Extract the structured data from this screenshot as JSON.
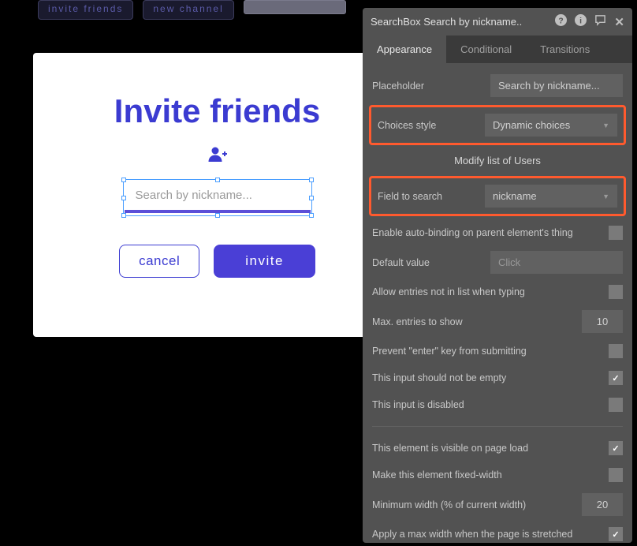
{
  "top": {
    "invite_friends": "invite friends",
    "new_channel": "new channel"
  },
  "modal": {
    "title": "Invite friends",
    "search_placeholder": "Search by nickname...",
    "cancel": "cancel",
    "invite": "invite"
  },
  "panel": {
    "title": "SearchBox Search by nickname..",
    "tabs": {
      "appearance": "Appearance",
      "conditional": "Conditional",
      "transitions": "Transitions"
    },
    "props": {
      "placeholder_label": "Placeholder",
      "placeholder_value": "Search by nickname...",
      "choices_style_label": "Choices style",
      "choices_style_value": "Dynamic choices",
      "modify_list": "Modify list of Users",
      "field_to_search_label": "Field to search",
      "field_to_search_value": "nickname",
      "enable_autobind": "Enable auto-binding on parent element's thing",
      "default_value_label": "Default value",
      "default_value_placeholder": "Click",
      "allow_entries": "Allow entries not in list when typing",
      "max_entries_label": "Max. entries to show",
      "max_entries_value": "10",
      "prevent_enter": "Prevent \"enter\" key from submitting",
      "not_empty": "This input should not be empty",
      "disabled": "This input is disabled",
      "visible_on_load": "This element is visible on page load",
      "fixed_width": "Make this element fixed-width",
      "min_width_label": "Minimum width (% of current width)",
      "min_width_value": "20",
      "max_width": "Apply a max width when the page is stretched"
    }
  }
}
